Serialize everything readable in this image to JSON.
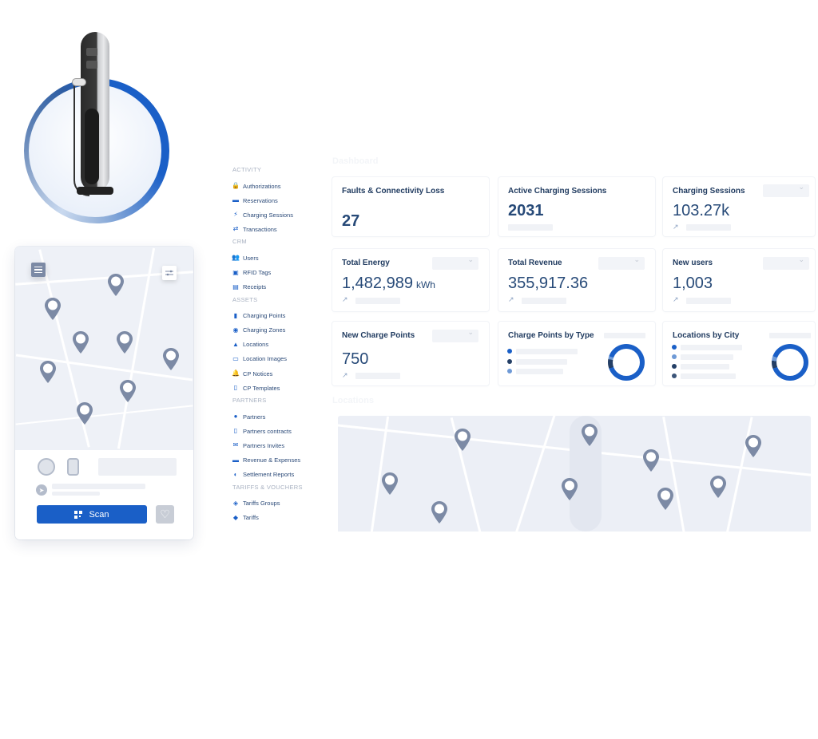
{
  "illustration": {
    "name": "ev-charger"
  },
  "mobile_app": {
    "scan_label": "Scan",
    "icons": [
      "menu-icon",
      "filter-icon",
      "type2-connector-icon",
      "ccs-connector-icon",
      "navigate-icon",
      "qr-code-icon",
      "heart-icon"
    ]
  },
  "sidebar": {
    "sections": [
      {
        "title": "ACTIVITY",
        "items": [
          {
            "label": "Authorizations",
            "icon": "🔒"
          },
          {
            "label": "Reservations",
            "icon": "▬"
          },
          {
            "label": "Charging Sessions",
            "icon": "⚡"
          },
          {
            "label": "Transactions",
            "icon": "⇄"
          }
        ]
      },
      {
        "title": "CRM",
        "items": [
          {
            "label": "Users",
            "icon": "👥"
          },
          {
            "label": "RFID Tags",
            "icon": "▣"
          },
          {
            "label": "Receipts",
            "icon": "▤"
          }
        ]
      },
      {
        "title": "ASSETS",
        "items": [
          {
            "label": "Charging Points",
            "icon": "▮"
          },
          {
            "label": "Charging Zones",
            "icon": "◉"
          },
          {
            "label": "Locations",
            "icon": "▲"
          },
          {
            "label": "Location Images",
            "icon": "▭"
          },
          {
            "label": "CP Notices",
            "icon": "🔔"
          },
          {
            "label": "CP Templates",
            "icon": "▯"
          }
        ]
      },
      {
        "title": "PARTNERS",
        "items": [
          {
            "label": "Partners",
            "icon": "●"
          },
          {
            "label": "Partners contracts",
            "icon": "▯"
          },
          {
            "label": "Partners Invites",
            "icon": "✉"
          },
          {
            "label": "Revenue & Expenses",
            "icon": "▬"
          },
          {
            "label": "Settlement Reports",
            "icon": "◐"
          }
        ]
      },
      {
        "title": "TARIFFS & VOUCHERS",
        "items": [
          {
            "label": "Tariffs Groups",
            "icon": "◈"
          },
          {
            "label": "Tariffs",
            "icon": "◆"
          }
        ]
      }
    ]
  },
  "dashboard": {
    "title": "Dashboard",
    "cards": {
      "faults": {
        "title": "Faults & Connectivity Loss",
        "value": "27"
      },
      "active_sessions": {
        "title": "Active Charging Sessions",
        "value": "2031"
      },
      "charging_sessions": {
        "title": "Charging Sessions",
        "value": "103.27k"
      },
      "total_energy": {
        "title": "Total Energy",
        "value": "1,482,989",
        "unit": "kWh"
      },
      "total_revenue": {
        "title": "Total Revenue",
        "value": "355,917.36"
      },
      "new_users": {
        "title": "New users",
        "value": "1,003"
      },
      "new_charge_points": {
        "title": "New Charge Points",
        "value": "750"
      },
      "cp_by_type": {
        "title": "Charge Points by Type",
        "legend_colors": [
          "#1a5fc7",
          "#243f66",
          "#6f9ad6"
        ]
      },
      "locations_by_city": {
        "title": "Locations by City",
        "legend_colors": [
          "#1a5fc7",
          "#6f9ad6",
          "#243f66",
          "#3b5478"
        ]
      }
    },
    "trend_icon": "↗"
  },
  "locations": {
    "title": "Locations"
  },
  "colors": {
    "accent": "#1a5fc7",
    "text": "#1f3a5f",
    "pin": "#7c8aa5",
    "map": "#eceff6"
  }
}
